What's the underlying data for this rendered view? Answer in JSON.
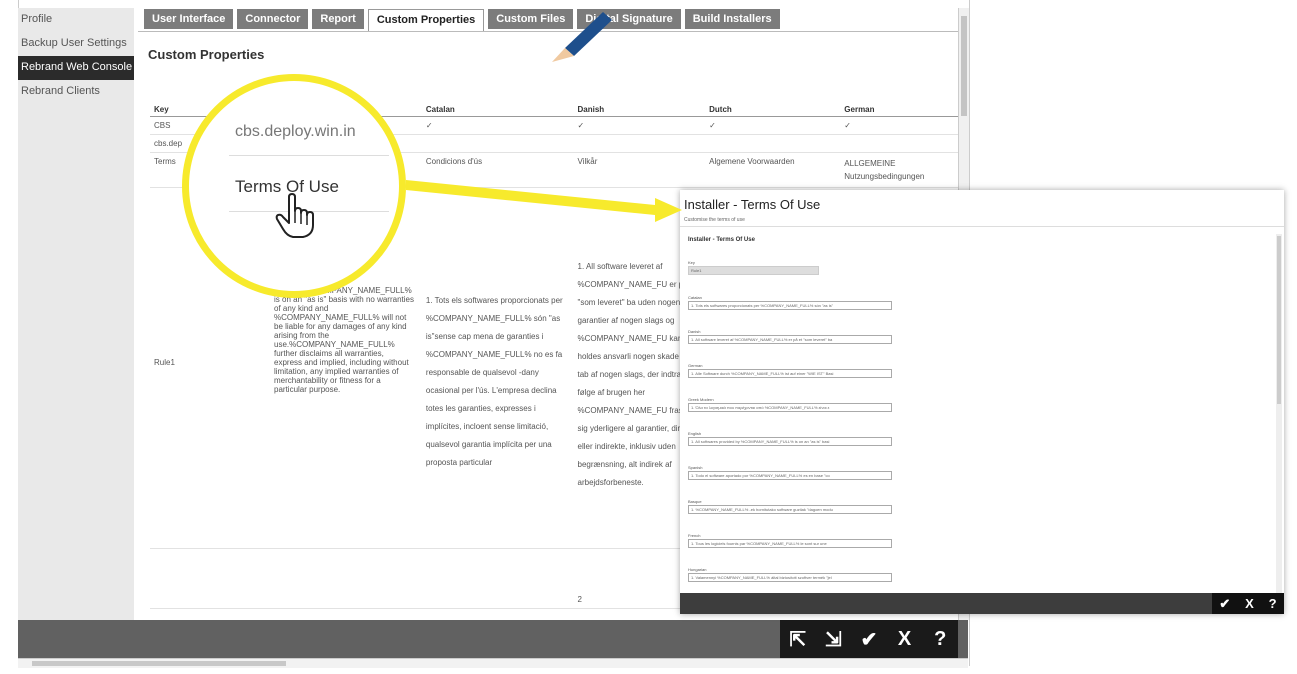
{
  "sidebar": {
    "items": [
      {
        "label": "Profile"
      },
      {
        "label": "Backup User Settings"
      },
      {
        "label": "Rebrand Web Console"
      },
      {
        "label": "Rebrand Clients"
      }
    ]
  },
  "tabs": [
    {
      "label": "User Interface"
    },
    {
      "label": "Connector"
    },
    {
      "label": "Report"
    },
    {
      "label": "Custom Properties"
    },
    {
      "label": "Custom Files"
    },
    {
      "label": "Digital Signature"
    },
    {
      "label": "Build Installers"
    }
  ],
  "content": {
    "title": "Custom Properties",
    "headers": [
      "Key",
      "Catalan",
      "Danish",
      "Dutch",
      "German"
    ],
    "rows": [
      {
        "key": "CBS",
        "catalan": "✓",
        "danish": "✓",
        "dutch": "✓",
        "german": "✓"
      },
      {
        "key": "cbs.dep",
        "catalan": "",
        "danish": "",
        "dutch": "",
        "german": ""
      },
      {
        "key": "Terms",
        "catalan": "Condicions d'ús",
        "danish": "Vilkår",
        "dutch": "Algemene Voorwaarden",
        "german": "ALLGEMEINE Nutzungsbedingungen"
      },
      {
        "key": "Rule1",
        "english": "vided by %COMPANY_NAME_FULL% is on an \"as is\" basis with no warranties of any kind and %COMPANY_NAME_FULL% will not be liable for any damages of any kind arising from the use.%COMPANY_NAME_FULL% further disclaims all warranties, express and implied, including without limitation, any implied warranties of merchantability or fitness for a particular purpose.",
        "catalan": "1. Tots els softwares proporcionats per %COMPANY_NAME_FULL% són \"as is\"sense cap mena de garanties i %COMPANY_NAME_FULL% no es fa responsable de qualsevol -dany ocasional per l'ús. L'empresa declina totes les garanties, expresses i implícites, incloent sense limitació, qualsevol garantia implícita per una proposta particular",
        "danish": "1. All software leveret af %COMPANY_NAME_FU er på et \"som leveret\" ba uden nogen garantier af nogen slags og %COMPANY_NAME_FU kan ikke holdes ansvarli nogen skade eller tab af nogen slags, der indtræ som følge af brugen her %COMPANY_NAME_FU frasiger sig yderligere al garantier, direkte eller indirekte, inklusiv uden begrænsning, alt indirek af arbejdsforbeneste."
      }
    ],
    "footer_number": "2"
  },
  "magnifier": {
    "key_text": "cbs.deploy.win.in",
    "term_text": "Terms Of Use"
  },
  "toolbar": {
    "export": "⇱",
    "import": "⇲",
    "save": "✔",
    "cancel": "X",
    "help": "?"
  },
  "dialog": {
    "title": "Installer - Terms Of Use",
    "subtitle": "Customise the terms of use",
    "inner_title": "Installer - Terms Of Use",
    "key_label": "Key",
    "key_value": "Rule1",
    "fields": [
      {
        "label": "Catalan",
        "value": "1. Tots els softwares proporcionats per %COMPANY_NAME_FULL% són \"as is\""
      },
      {
        "label": "Danish",
        "value": "1. All software leveret af %COMPANY_NAME_FULL% er på et \"som leveret\" ba"
      },
      {
        "label": "German",
        "value": "1. Alle Software durch %COMPANY_NAME_FULL% ist auf einer \"WIE IST\" Basi"
      },
      {
        "label": "Greek Modern",
        "value": "1. Όλα τα λογισμικά που παρέχονται από %COMPANY_NAME_FULL% είναι ε"
      },
      {
        "label": "English",
        "value": "1. All softwares provided by %COMPANY_NAME_FULL% is on an \"as is\" basi"
      },
      {
        "label": "Spanish",
        "value": "1. Todo el software aportado por %COMPANY_NAME_FULL% es en base \"co"
      },
      {
        "label": "Basque",
        "value": "1. %COMPANY_NAME_FULL% -ek hornitutako software guztiak \"dagoen modu"
      },
      {
        "label": "French",
        "value": "1. Tous les logiciels fournis par %COMPANY_NAME_FULL% le sont sur une"
      },
      {
        "label": "Hungarian",
        "value": "1. Valamennyi %COMPANY_NAME_FULL% által biztosított szoftver termék \"jel"
      }
    ],
    "actions": {
      "save": "✔",
      "cancel": "X",
      "help": "?"
    }
  },
  "colors": {
    "highlight": "#f7ea2c",
    "dark_bar": "#1a1a1a",
    "tab_bg": "#7c7c7c",
    "arrow_blue": "#1e4f8c",
    "arrow_red": "#e0202a"
  }
}
